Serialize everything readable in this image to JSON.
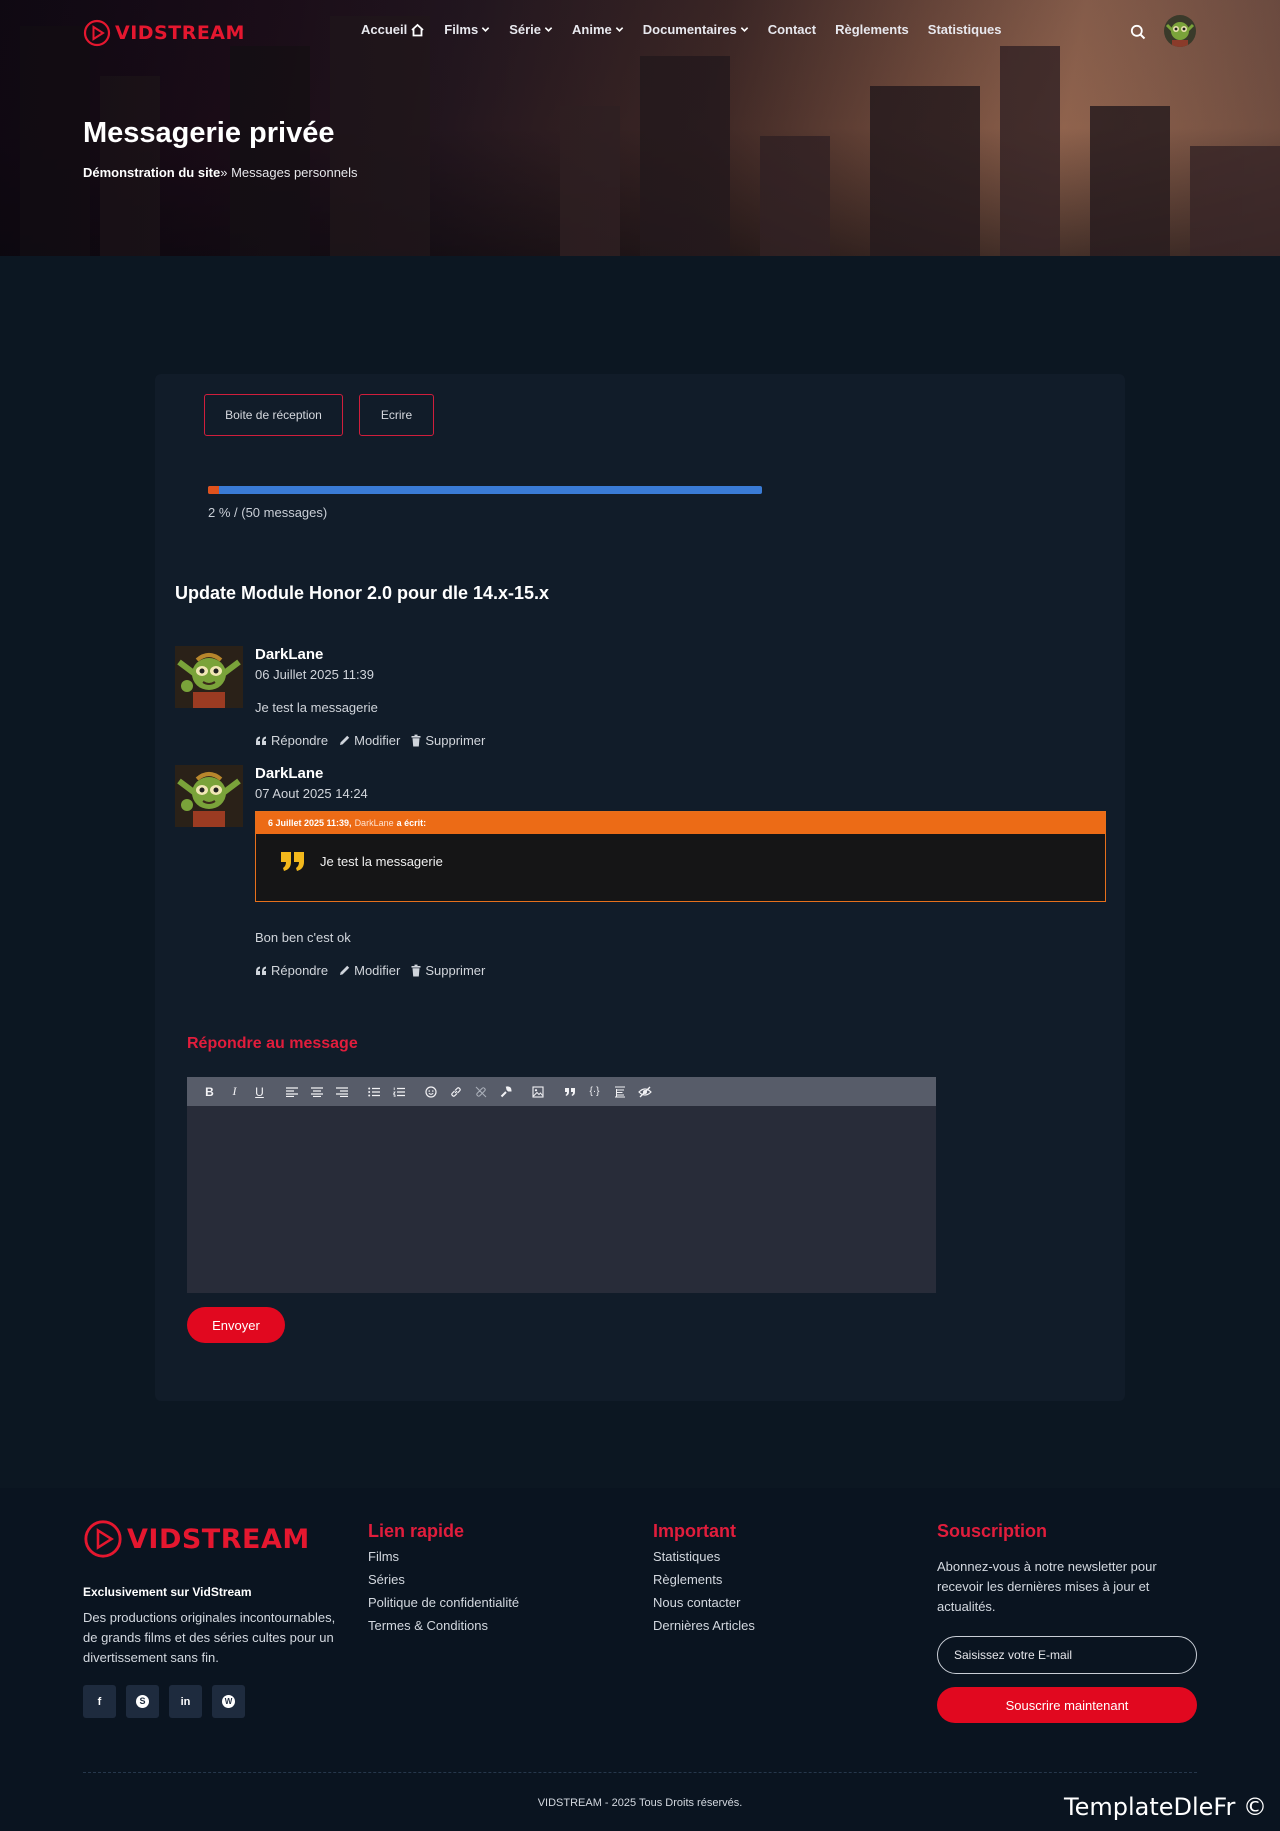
{
  "brand": {
    "name": "VIDSTREAM",
    "color": "#e5172f"
  },
  "nav": {
    "items": [
      {
        "label": "Accueil",
        "icon": "home-icon"
      },
      {
        "label": "Films",
        "icon": "chevron-down-icon"
      },
      {
        "label": "Série",
        "icon": "chevron-down-icon"
      },
      {
        "label": "Anime",
        "icon": "chevron-down-icon"
      },
      {
        "label": "Documentaires",
        "icon": "chevron-down-icon"
      },
      {
        "label": "Contact"
      },
      {
        "label": "Règlements"
      },
      {
        "label": "Statistiques"
      }
    ],
    "search_icon": "search-icon"
  },
  "hero": {
    "title": "Messagerie privée",
    "breadcrumb_home": "Démonstration du site",
    "breadcrumb_sep": "»",
    "breadcrumb_current": " Messages personnels"
  },
  "pm": {
    "tabs": {
      "inbox": "Boite de réception",
      "compose": "Ecrire"
    },
    "quota": {
      "percent": 2,
      "text": "2 % / (50 messages)"
    },
    "subject": "Update Module Honor 2.0 pour dle 14.x-15.x",
    "actions": {
      "reply": "Répondre",
      "edit": "Modifier",
      "delete": "Supprimer"
    },
    "messages": [
      {
        "author": "DarkLane",
        "date": "06 Juillet 2025 11:39",
        "body": "Je test la messagerie"
      },
      {
        "author": "DarkLane",
        "date": "07 Aout 2025 14:24",
        "quote": {
          "date": "6 Juillet 2025 11:39,",
          "author": "DarkLane",
          "wrote": "a écrit:",
          "text": "Je test la messagerie"
        },
        "body": "Bon ben c'est ok"
      }
    ],
    "reply": {
      "title": "Répondre au message",
      "send_label": "Envoyer"
    },
    "editor_toolbar": [
      "bold",
      "italic",
      "underline",
      "align-left",
      "align-center",
      "align-right",
      "bullet-list",
      "numbered-list",
      "emoji",
      "link",
      "unlink",
      "wrench",
      "image",
      "quote",
      "code",
      "spoiler",
      "hide"
    ]
  },
  "footer": {
    "tagline_bold": "Exclusivement sur VidStream",
    "tagline": "Des productions originales incontournables, de grands films et des séries cultes pour un divertissement sans fin.",
    "quick_links": {
      "title": "Lien rapide",
      "items": [
        "Films",
        "Séries",
        "Politique de confidentialité",
        "Termes & Conditions"
      ]
    },
    "important": {
      "title": "Important",
      "items": [
        "Statistiques",
        "Règlements",
        "Nous contacter",
        "Dernières Articles"
      ]
    },
    "subscribe": {
      "title": "Souscription",
      "text": "Abonnez-vous à notre newsletter pour recevoir les dernières mises à jour et actualités.",
      "placeholder": "Saisissez votre E-mail",
      "button": "Souscrire maintenant"
    },
    "socials": [
      "f",
      "S",
      "in",
      "W"
    ],
    "copyright": "VIDSTREAM - 2025 Tous Droits réservés."
  },
  "watermark": "TemplateDleFr ©"
}
